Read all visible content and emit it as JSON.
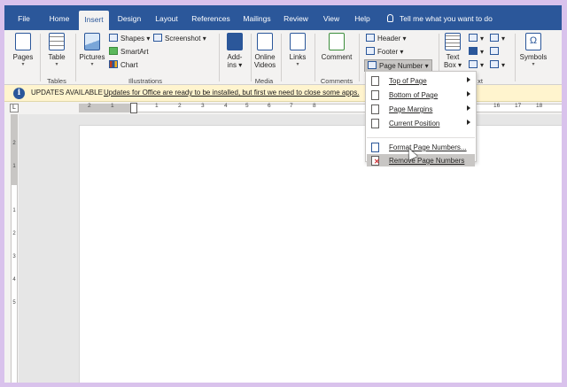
{
  "tabs": [
    "File",
    "Home",
    "Insert",
    "Design",
    "Layout",
    "References",
    "Mailings",
    "Review",
    "View",
    "Help"
  ],
  "active_tab": "Insert",
  "tell_me": "Tell me what you want to do",
  "ribbon": {
    "pages": "Pages",
    "table": "Table",
    "pictures": "Pictures",
    "shapes": "Shapes",
    "screenshot": "Screenshot",
    "smartart": "SmartArt",
    "chart": "Chart",
    "addins_line1": "Add-",
    "addins_line2": "ins",
    "online_videos_line1": "Online",
    "online_videos_line2": "Videos",
    "links": "Links",
    "comment": "Comment",
    "header": "Header",
    "footer": "Footer",
    "page_number": "Page Number",
    "text_box_line1": "Text",
    "text_box_line2": "Box",
    "symbols": "Symbols",
    "groups": {
      "tables": "Tables",
      "illustrations": "Illustrations",
      "media": "Media",
      "comments": "Comments",
      "text_partial": "xt"
    }
  },
  "update_bar": {
    "title": "UPDATES AVAILABLE",
    "message": "Updates for Office are ready to be installed, but first we need to close some apps."
  },
  "ruler": {
    "numbers": [
      "2",
      "1",
      "1",
      "2",
      "3",
      "4",
      "5",
      "6",
      "7",
      "8",
      "9",
      "16",
      "17",
      "18"
    ],
    "vertical_numbers": [
      "2",
      "1",
      "1",
      "2",
      "3",
      "4",
      "5"
    ]
  },
  "page_number_menu": {
    "items": [
      {
        "label": "Top of Page",
        "submenu": true
      },
      {
        "label": "Bottom of Page",
        "submenu": true
      },
      {
        "label": "Page Margins",
        "submenu": true
      },
      {
        "label": "Current Position",
        "submenu": true
      },
      {
        "label": "Format Page Numbers...",
        "submenu": false
      },
      {
        "label": "Remove Page Numbers",
        "submenu": false
      }
    ],
    "highlighted": "Remove Page Numbers"
  },
  "colors": {
    "title_bar": "#2b579a",
    "ribbon_bg": "#f3f2f1",
    "update_bar": "#fff4ce",
    "highlight": "#c8c6c4",
    "window_border": "#d9c2ec"
  }
}
